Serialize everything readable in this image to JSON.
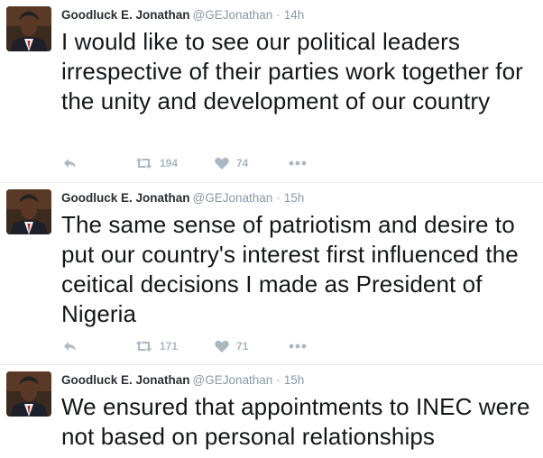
{
  "colors": {
    "text": "#14171a",
    "name": "#292f33",
    "muted": "#8899a6",
    "icon": "#aab8c2",
    "divider": "#e6ecf0"
  },
  "icons": {
    "reply": "reply-icon",
    "retweet": "retweet-icon",
    "like": "heart-icon",
    "more": "more-dots-icon"
  },
  "tweets": [
    {
      "name": "Goodluck E. Jonathan",
      "handle": "@GEJonathan",
      "separator": "·",
      "time": "14h",
      "text": "I would like to see our political leaders irrespective of their parties work together for the unity and development of our country",
      "retweets": "194",
      "likes": "74"
    },
    {
      "name": "Goodluck E. Jonathan",
      "handle": "@GEJonathan",
      "separator": "·",
      "time": "15h",
      "text": "The same sense of patriotism and desire to put our country's interest first influenced the ceitical decisions I made as President of Nigeria",
      "retweets": "171",
      "likes": "71"
    },
    {
      "name": "Goodluck E. Jonathan",
      "handle": "@GEJonathan",
      "separator": "·",
      "time": "15h",
      "text": "We ensured that appointments to INEC were not based on personal relationships"
    }
  ]
}
